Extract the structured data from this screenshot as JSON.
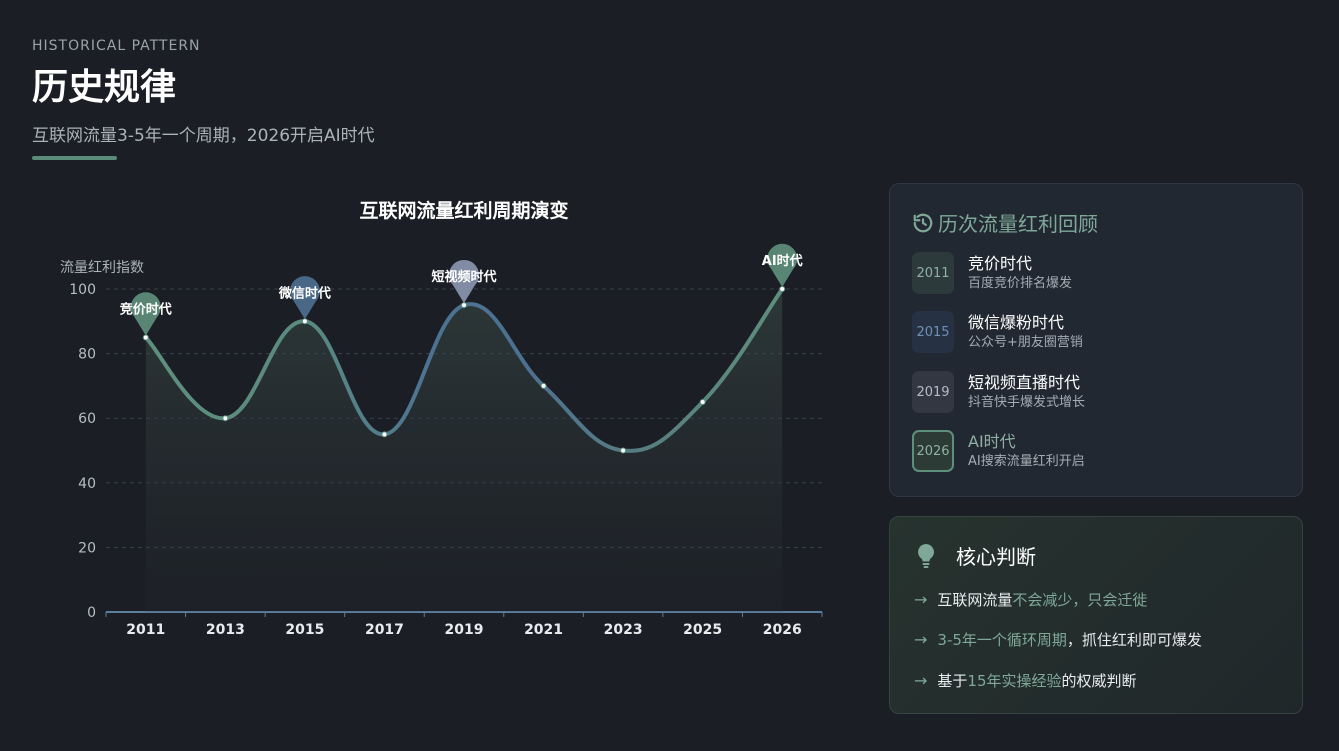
{
  "header": {
    "eyebrow": "HISTORICAL PATTERN",
    "title": "历史规律",
    "subtitle": "互联网流量3-5年一个周期，2026开启AI时代"
  },
  "chart_data": {
    "type": "line",
    "title": "互联网流量红利周期演变",
    "ylabel": "流量红利指数",
    "xlabel": "",
    "categories": [
      "2011",
      "2013",
      "2015",
      "2017",
      "2019",
      "2021",
      "2023",
      "2025",
      "2026"
    ],
    "y_ticks": [
      "0",
      "20",
      "40",
      "60",
      "80",
      "100"
    ],
    "ylim": [
      0,
      100
    ],
    "grid": true,
    "series": [
      {
        "x": [
          2011,
          2013,
          2015,
          2017,
          2019,
          2021,
          2023,
          2025,
          2026
        ],
        "values": [
          85,
          60,
          90,
          55,
          95,
          70,
          50,
          65,
          100
        ]
      }
    ],
    "markers": [
      {
        "label": "竞价时代",
        "x": 2011,
        "y": 85,
        "color": "#5e8f7c"
      },
      {
        "label": "微信时代",
        "x": 2015,
        "y": 90,
        "color": "#4d6f91"
      },
      {
        "label": "短视频时代",
        "x": 2019,
        "y": 95,
        "color": "#8a96b0"
      },
      {
        "label": "AI时代",
        "x": 2026,
        "y": 100,
        "color": "#5e8f7c"
      }
    ]
  },
  "history": {
    "title": "历次流量红利回顾",
    "items": [
      {
        "year": "2011",
        "name": "竞价时代",
        "desc": "百度竞价排名爆发",
        "bg": "#2d3a3c",
        "border": "#2d3a3c",
        "color": "#8fb0a3"
      },
      {
        "year": "2015",
        "name": "微信爆粉时代",
        "desc": "公众号+朋友圈营销",
        "bg": "#263244",
        "border": "#263244",
        "color": "#6f8fb4"
      },
      {
        "year": "2019",
        "name": "短视频直播时代",
        "desc": "抖音快手爆发式增长",
        "bg": "#323742",
        "border": "#323742",
        "color": "#b4bccb"
      },
      {
        "year": "2026",
        "name": "AI时代",
        "desc": "AI搜索流量红利开启",
        "bg": "#2c3b36",
        "border": "#5e8f7c",
        "color": "#8fb0a3"
      }
    ]
  },
  "core": {
    "title": "核心判断",
    "items": [
      {
        "pre": "互联网流量",
        "hl": "不会减少，只会迁徙",
        "post": ""
      },
      {
        "pre": "",
        "hl": "3-5年一个循环周期",
        "post": "，抓住红利即可爆发"
      },
      {
        "pre": "基于",
        "hl": "15年实操经验",
        "post": "的权威判断"
      }
    ]
  }
}
